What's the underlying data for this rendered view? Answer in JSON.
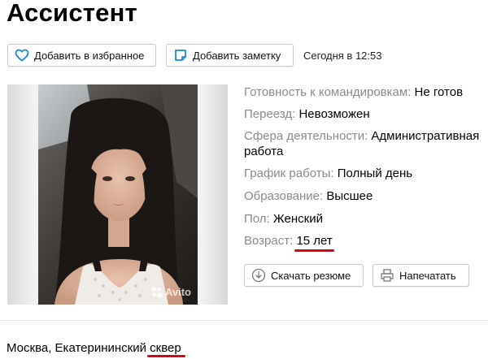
{
  "header": {
    "title": "Ассистент"
  },
  "actions": {
    "favorite_label": "Добавить в избранное",
    "note_label": "Добавить заметку",
    "date_text": "Сегодня в 12:53"
  },
  "photo": {
    "watermark": "Avito"
  },
  "details": [
    {
      "label": "Готовность к командировкам:",
      "value": "Не готов"
    },
    {
      "label": "Переезд:",
      "value": "Невозможен"
    },
    {
      "label": "Сфера деятельности:",
      "value": "Административная работа"
    },
    {
      "label": "График работы:",
      "value": "Полный день"
    },
    {
      "label": "Образование:",
      "value": "Высшее"
    },
    {
      "label": "Пол:",
      "value": "Женский"
    },
    {
      "label": "Возраст:",
      "value": "15 лет"
    }
  ],
  "resume_actions": {
    "download_label": "Скачать резюме",
    "print_label": "Напечатать"
  },
  "location": {
    "city_prefix": "Москва, Екатерининский",
    "street_word": "сквер"
  },
  "colors": {
    "highlight_underline": "#d2081b",
    "label_gray": "#8a8a8a",
    "favorite_icon": "#1a8ad8",
    "note_icon": "#1a8ad8"
  },
  "icons": {
    "favorite": "heart-icon",
    "note": "note-icon",
    "download": "download-icon",
    "print": "printer-icon"
  }
}
